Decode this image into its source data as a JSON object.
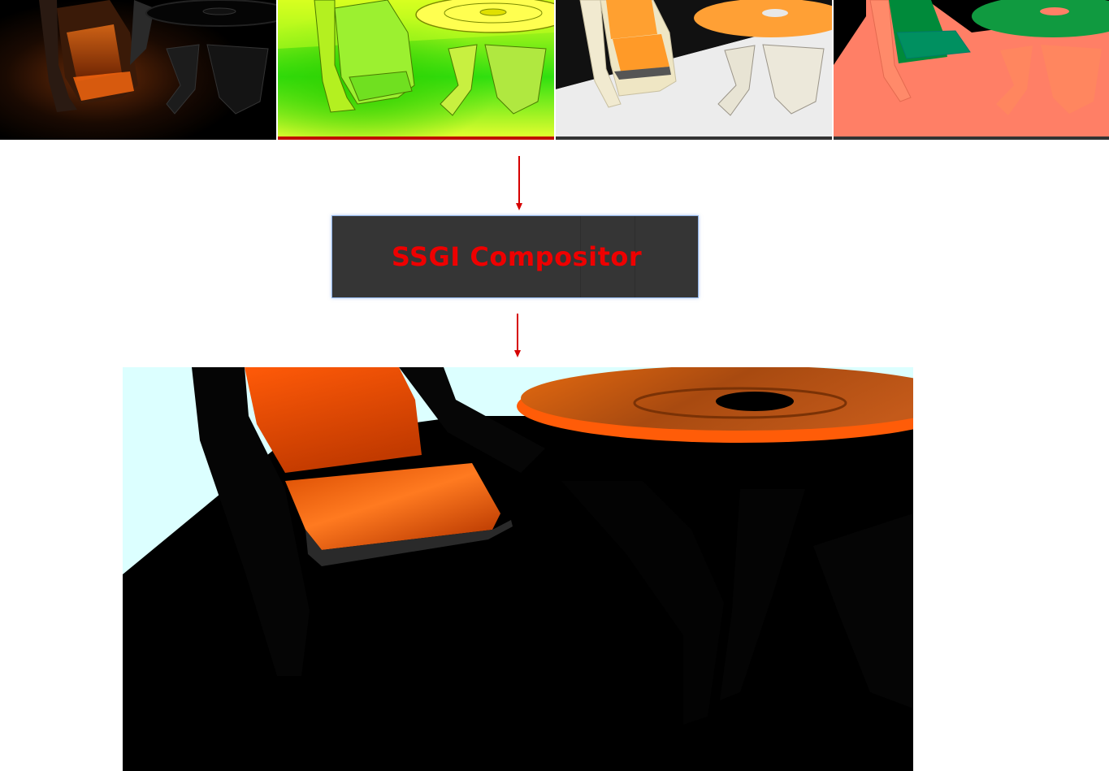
{
  "compositor": {
    "label": "SSGI Compositor",
    "label_color": "#ee0000",
    "box_color": "#353535"
  },
  "inputs": [
    {
      "name": "indirect-lighting-pass",
      "colors": [
        "#000000",
        "#ff5a00"
      ]
    },
    {
      "name": "normal-pass",
      "colors": [
        "#b8ff00",
        "#ffff00",
        "#00d000"
      ]
    },
    {
      "name": "albedo-pass",
      "colors": [
        "#ffa030",
        "#f4f4f4",
        "#f0ecd6"
      ]
    },
    {
      "name": "id-pass",
      "colors": [
        "#ff7f66",
        "#008a3a",
        "#ff8a4a"
      ]
    }
  ],
  "arrows": {
    "color": "#d60000"
  },
  "output": {
    "name": "composited-ssgi-render",
    "colors": [
      "#000000",
      "#ff5a00",
      "#dcffff"
    ]
  }
}
